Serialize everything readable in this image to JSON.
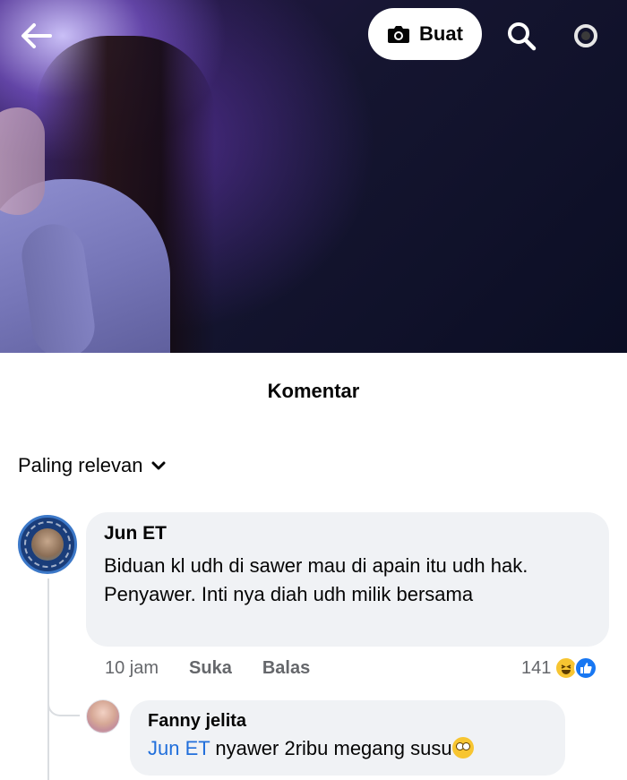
{
  "header": {
    "create_label": "Buat",
    "icons": {
      "back": "arrow-left-icon",
      "create": "camera-icon",
      "search": "search-icon",
      "settings": "gear-icon"
    }
  },
  "comments": {
    "title": "Komentar",
    "sort_label": "Paling relevan"
  },
  "comment": {
    "author": "Jun ET",
    "text": "Biduan kl udh di sawer mau di apain itu udh hak. Penyawer. Inti nya diah udh milik bersama",
    "time": "10 jam",
    "like_label": "Suka",
    "reply_label": "Balas",
    "reaction_count": "141"
  },
  "reply": {
    "author": "Fanny jelita",
    "mention": "Jun ET",
    "text": " nyawer 2ribu megang susu"
  },
  "colors": {
    "bubble_bg": "#f0f2f5",
    "mention": "#216fdb",
    "meta_text": "#65676b",
    "like_blue": "#1877f2",
    "haha_yellow": "#f7c531"
  }
}
